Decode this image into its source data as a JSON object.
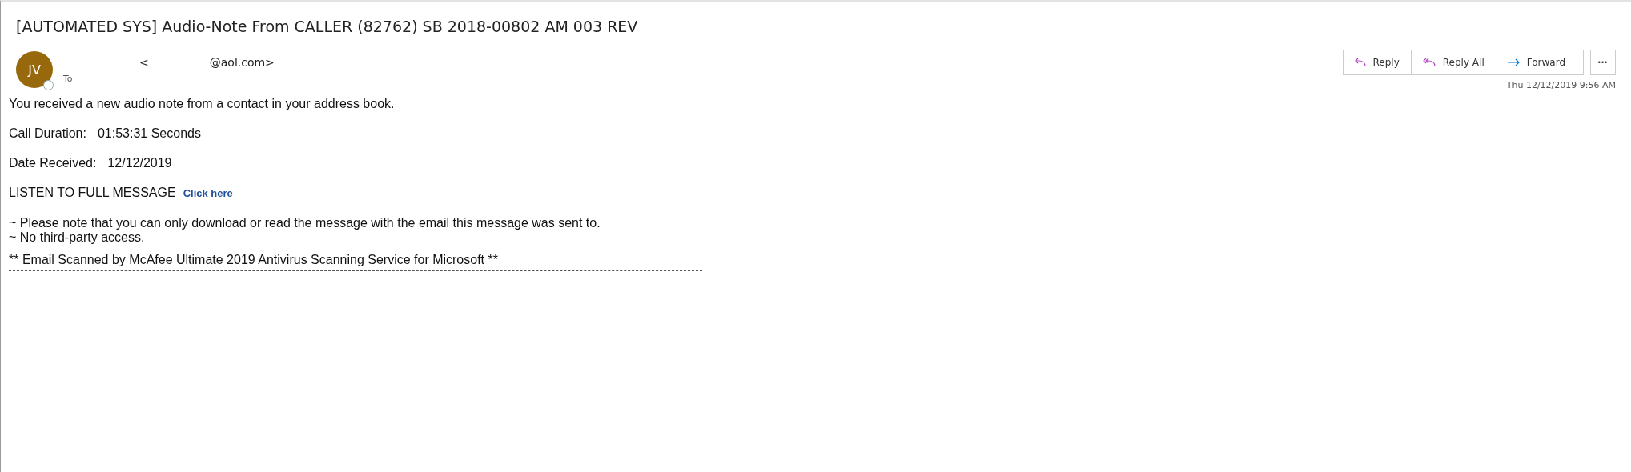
{
  "subject": "[AUTOMATED SYS] Audio-Note From CALLER (82762) SB 2018-00802 AM 003 REV",
  "sender": {
    "initials": "JV",
    "color": "#98690c",
    "bracket": "<",
    "address": "@aol.com>",
    "to_label": "To"
  },
  "actions": [
    {
      "kind": "reply",
      "label": "Reply"
    },
    {
      "kind": "reply_all",
      "label": "Reply All"
    },
    {
      "kind": "forward",
      "label": "Forward"
    }
  ],
  "more": "•••",
  "timestamp": "Thu 12/12/2019 9:56 AM",
  "body": [
    {
      "kind": "text",
      "text": "You received a new audio note from a contact in your address book."
    },
    {
      "kind": "field",
      "label": "Call Duration:",
      "value": "01:53:31 Seconds"
    },
    {
      "kind": "field",
      "label": "Date Received:",
      "value": "12/12/2019"
    },
    {
      "kind": "link",
      "text": "LISTEN TO FULL MESSAGE",
      "link": "Click here"
    },
    {
      "kind": "notes",
      "lines": [
        "~ Please note that you can only download or read the message with the email this message was sent to.",
        "~ No third-party access."
      ]
    },
    {
      "kind": "banner",
      "text": "** Email Scanned by McAfee Ultimate 2019 Antivirus Scanning Service for Microsoft **"
    }
  ]
}
